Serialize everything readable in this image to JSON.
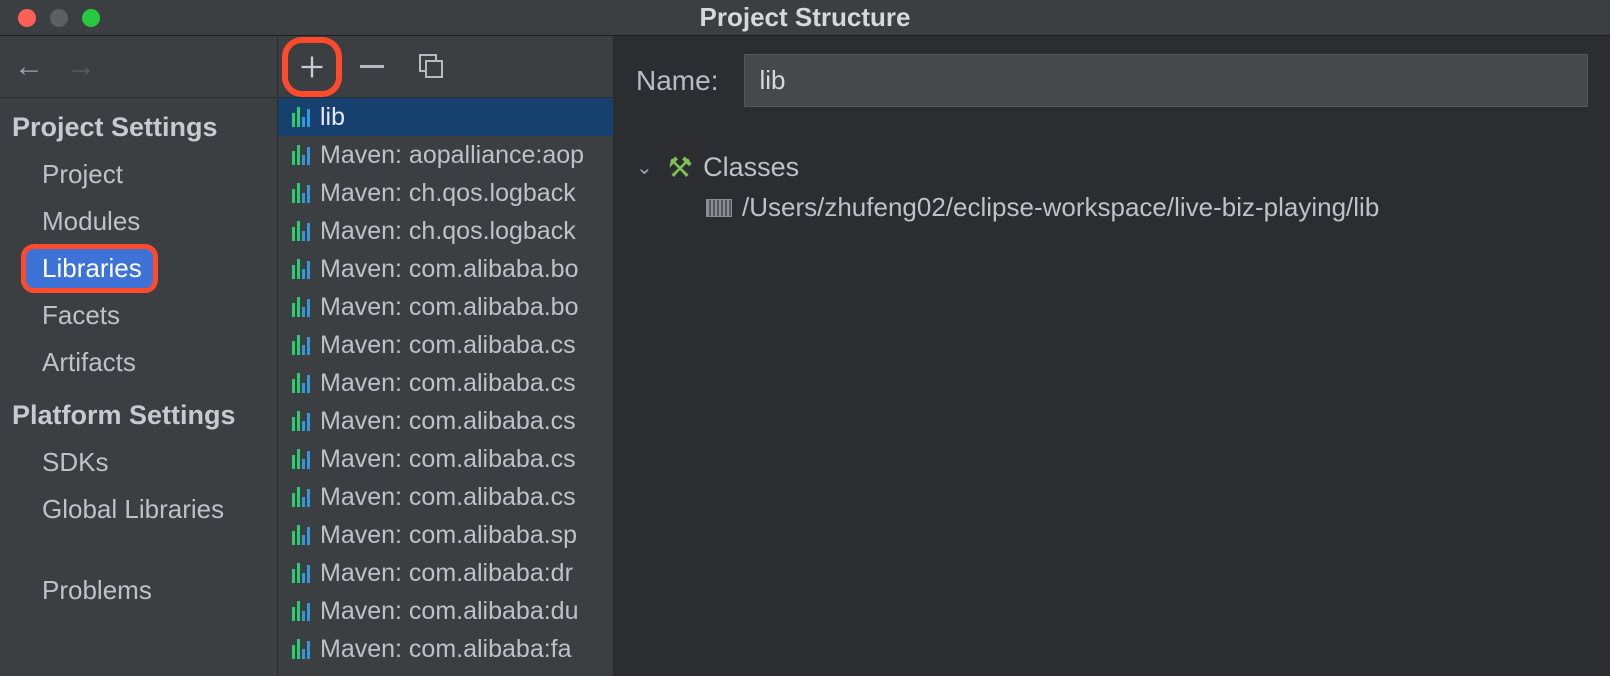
{
  "window": {
    "title": "Project Structure"
  },
  "sidebar": {
    "projectSettingsHeader": "Project Settings",
    "platformSettingsHeader": "Platform Settings",
    "items": {
      "project": "Project",
      "modules": "Modules",
      "libraries": "Libraries",
      "facets": "Facets",
      "artifacts": "Artifacts",
      "sdks": "SDKs",
      "globalLibraries": "Global Libraries",
      "problems": "Problems"
    },
    "selected": "libraries"
  },
  "libraryList": {
    "selected": "lib",
    "items": [
      "lib",
      "Maven: aopalliance:aop",
      "Maven: ch.qos.logback",
      "Maven: ch.qos.logback",
      "Maven: com.alibaba.bo",
      "Maven: com.alibaba.bo",
      "Maven: com.alibaba.cs",
      "Maven: com.alibaba.cs",
      "Maven: com.alibaba.cs",
      "Maven: com.alibaba.cs",
      "Maven: com.alibaba.cs",
      "Maven: com.alibaba.sp",
      "Maven: com.alibaba:dr",
      "Maven: com.alibaba:du",
      "Maven: com.alibaba:fa"
    ]
  },
  "detail": {
    "nameLabel": "Name:",
    "nameValue": "lib",
    "classesLabel": "Classes",
    "classPath": "/Users/zhufeng02/eclipse-workspace/live-biz-playing/lib"
  }
}
